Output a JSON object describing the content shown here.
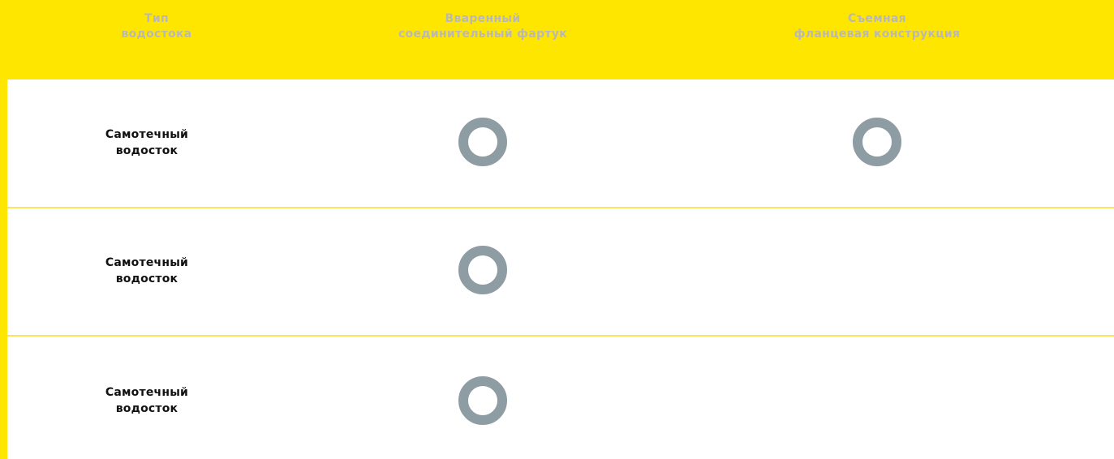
{
  "header": {
    "col1": [
      "Тип",
      "водостока"
    ],
    "col2": [
      "Вваренный",
      "соединительный фартук"
    ],
    "col3": [
      "Съемная",
      "фланцевая конструкция"
    ]
  },
  "rows": [
    {
      "label": [
        "Самотечный",
        "водосток"
      ],
      "welded_flange": true,
      "removable_flange": true
    },
    {
      "label": [
        "Самотечный",
        "водосток"
      ],
      "welded_flange": true,
      "removable_flange": false
    },
    {
      "label": [
        "Самотечный",
        "водосток"
      ],
      "welded_flange": true,
      "removable_flange": false
    }
  ],
  "colors": {
    "accent_yellow": "#FFE600",
    "separator_yellow": "#FFE15A",
    "header_text": "#b8b8b8",
    "marker_gray": "#8E9CA4",
    "body_text": "#111111"
  },
  "icons": {
    "marker": "ring-marker-icon"
  }
}
